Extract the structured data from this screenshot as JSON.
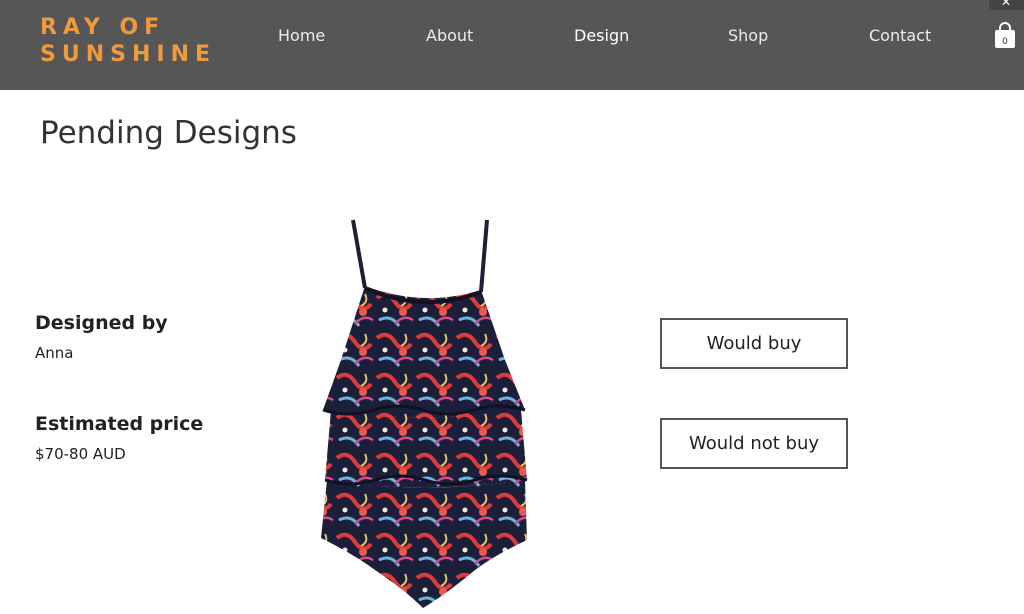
{
  "brand": {
    "line1": "RAY OF",
    "line2": "SUNSHINE"
  },
  "nav": {
    "home": "Home",
    "about": "About",
    "design": "Design",
    "shop": "Shop",
    "contact": "Contact"
  },
  "cart": {
    "count": "0"
  },
  "page": {
    "title": "Pending Designs"
  },
  "design": {
    "designed_by_label": "Designed by",
    "designer": "Anna",
    "price_label": "Estimated price",
    "price": "$70-80 AUD",
    "image_name": "floral-ruffle-camisole"
  },
  "actions": {
    "buy": "Would buy",
    "not_buy": "Would not buy"
  },
  "colors": {
    "header_bg": "#575656",
    "brand": "#f09a3e"
  }
}
